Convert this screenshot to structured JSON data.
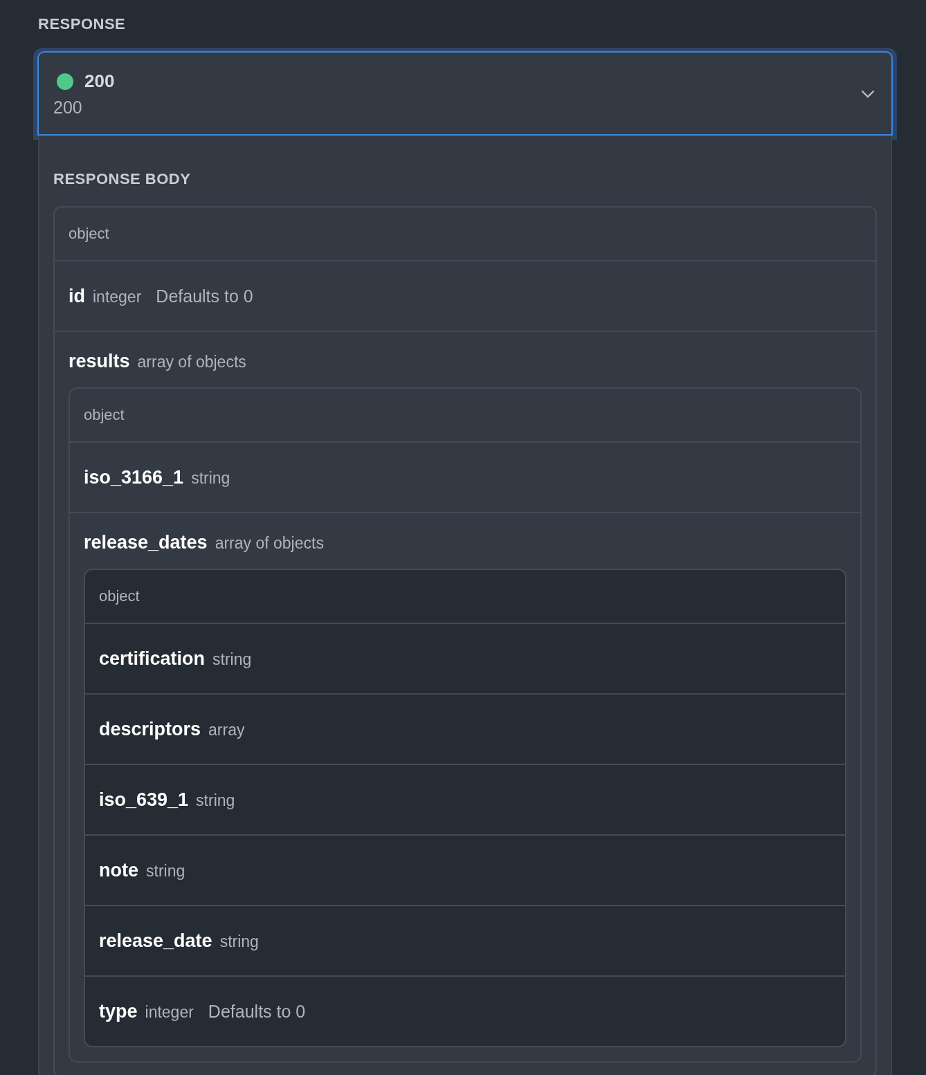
{
  "section_title": "RESPONSE",
  "response": {
    "color": "#4fc98a",
    "code": "200",
    "description": "200",
    "expanded": true,
    "body_title": "RESPONSE BODY",
    "schema": {
      "type_label": "object",
      "fields": [
        {
          "name": "id",
          "type": "integer",
          "default": "Defaults to 0"
        },
        {
          "name": "results",
          "type": "array of objects",
          "schema": {
            "type_label": "object",
            "fields": [
              {
                "name": "iso_3166_1",
                "type": "string"
              },
              {
                "name": "release_dates",
                "type": "array of objects",
                "schema": {
                  "type_label": "object",
                  "fields": [
                    {
                      "name": "certification",
                      "type": "string"
                    },
                    {
                      "name": "descriptors",
                      "type": "array"
                    },
                    {
                      "name": "iso_639_1",
                      "type": "string"
                    },
                    {
                      "name": "note",
                      "type": "string"
                    },
                    {
                      "name": "release_date",
                      "type": "string"
                    },
                    {
                      "name": "type",
                      "type": "integer",
                      "default": "Defaults to 0"
                    }
                  ]
                }
              }
            ]
          }
        }
      ]
    }
  }
}
